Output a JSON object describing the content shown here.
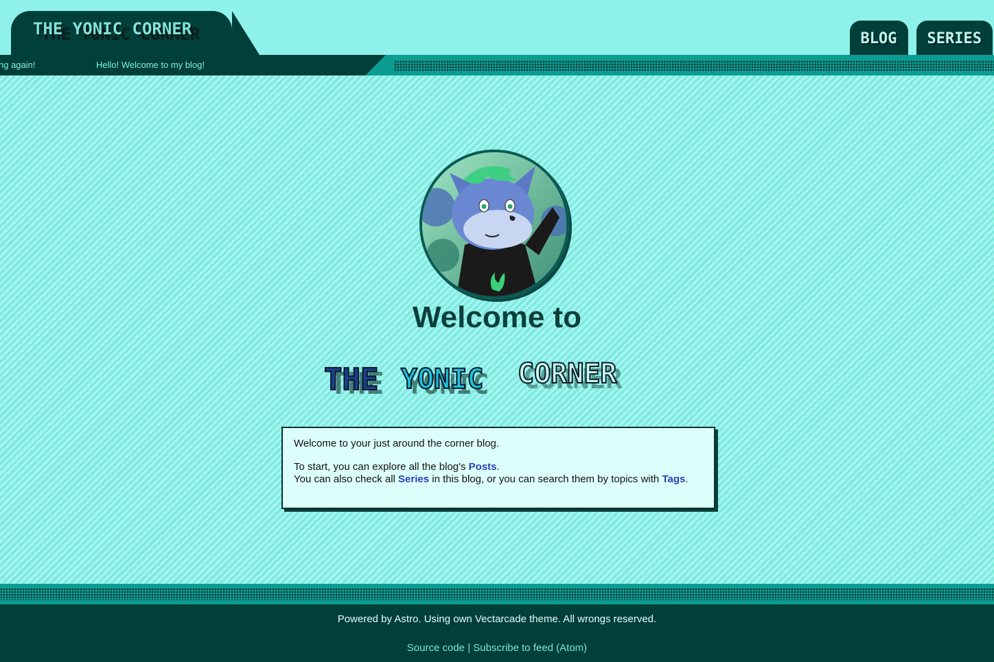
{
  "header": {
    "site_title": "The Yonic Corner",
    "nav": [
      {
        "label": "Blog"
      },
      {
        "label": "Series"
      }
    ],
    "marquee": [
      "ng again!",
      "Hello! Welcome to my blog!"
    ]
  },
  "main": {
    "welcome_heading": "Welcome to",
    "logo_words": [
      "THE",
      "YONIC",
      "CORNER"
    ],
    "card": {
      "line1": "Welcome to your just around the corner blog.",
      "line2_pre": "To start, you can explore all the blog's ",
      "posts_link": "Posts",
      "line2_post": ".",
      "line3_pre": "You can also check all ",
      "series_link": "Series",
      "line3_mid": " in this blog, or you can search them by topics with ",
      "tags_link": "Tags",
      "line3_post": "."
    }
  },
  "footer": {
    "powered": "Powered by Astro. Using own Vectarcade theme. All wrongs reserved.",
    "source_code": "Source code",
    "separator": " | ",
    "feed": "Subscribe to feed (Atom)"
  },
  "colors": {
    "background": "#8ff2ea",
    "dark_teal": "#003f3a",
    "accent_teal": "#0b9c92",
    "link_blue": "#2742b5"
  }
}
